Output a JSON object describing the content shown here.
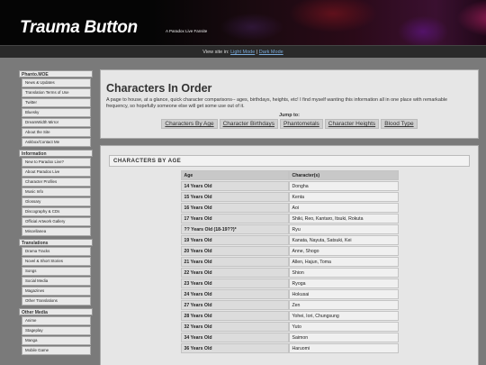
{
  "site": {
    "logo": "Trauma Button",
    "tagline": "A Paradox Live Fansite",
    "view_prefix": "View site in: ",
    "light_mode": "Light Mode",
    "separator": " | ",
    "dark_mode": "Dark Mode"
  },
  "sidebar": [
    {
      "heading": "Phanto.MOE",
      "items": [
        "News & Updates",
        "Translation Terms of Use",
        "Twitter",
        "Bluesky",
        "DreamWidth Mirror",
        "About the Site",
        "Askbox/Contact Me"
      ]
    },
    {
      "heading": "Information",
      "items": [
        "New to Paradox Live?",
        "About Paradox Live",
        "Character Profiles",
        "Music Info",
        "Glossary",
        "Discography & CDs",
        "Official Artwork Gallery",
        "Miscellanea"
      ]
    },
    {
      "heading": "Translations",
      "items": [
        "Drama Tracks",
        "Novel & Short Stories",
        "Songs",
        "Social Media",
        "Magazines",
        "Other Translations"
      ]
    },
    {
      "heading": "Other Media",
      "items": [
        "Anime",
        "Stageplay",
        "Manga",
        "Mobile Game"
      ]
    }
  ],
  "intro": {
    "title": "Characters In Order",
    "description": "A page to house, at a glance, quick character comparisons-- ages, birthdays, heights, etc! I find myself wanting this information all in one place with remarkable frequency, so hopefully someone else will get some use out of it.",
    "jump_label": "Jump to:",
    "jump_links": [
      "Characters By Age",
      "Character Birthdays",
      "Phantometals",
      "Character Heights",
      "Blood Type"
    ]
  },
  "age_section": {
    "title": "CHARACTERS BY AGE",
    "headers": [
      "Age",
      "Character(s)"
    ],
    "rows": [
      [
        "14 Years Old",
        "Dongha"
      ],
      [
        "15 Years Old",
        "Kenta"
      ],
      [
        "16 Years Old",
        "Aoi"
      ],
      [
        "17 Years Old",
        "Shiki, Reo, Kantaro, Itsuki, Rokuta"
      ],
      [
        "?? Years Old (18-19??)*",
        "Ryu"
      ],
      [
        "19 Years Old",
        "Kanata, Nayuta, Satsuki, Kei"
      ],
      [
        "20 Years Old",
        "Anne, Shogo"
      ],
      [
        "21 Years Old",
        "Allen, Hajun, Toma"
      ],
      [
        "22 Years Old",
        "Shion"
      ],
      [
        "23 Years Old",
        "Ryoga"
      ],
      [
        "24 Years Old",
        "Hokusai"
      ],
      [
        "27 Years Old",
        "Zen"
      ],
      [
        "28 Years Old",
        "Yohei, Iori, Chungsung"
      ],
      [
        "32 Years Old",
        "Yuto"
      ],
      [
        "34 Years Old",
        "Saimon"
      ],
      [
        "36 Years Old",
        "Haruomi"
      ]
    ]
  }
}
